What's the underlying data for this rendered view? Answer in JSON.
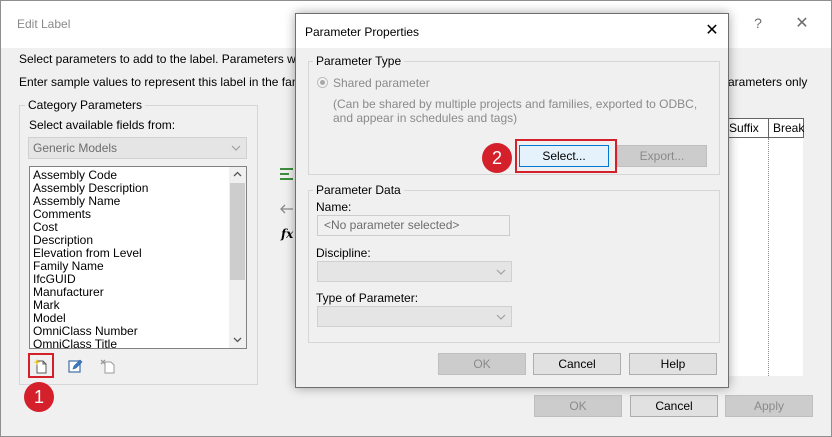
{
  "outer": {
    "title": "Edit Label",
    "help": "?",
    "close": "✕",
    "instruction1": "Select parameters to add to the label.  Parameters will be",
    "instruction2": "Enter sample values to represent this label in the family er",
    "instruction2_right": "arameters only",
    "category_group_label": "Category Parameters",
    "available_label": "Select available fields from:",
    "category_selected": "Generic Models",
    "fields": [
      "Assembly Code",
      "Assembly Description",
      "Assembly Name",
      "Comments",
      "Cost",
      "Description",
      "Elevation from Level",
      "Family Name",
      "IfcGUID",
      "Manufacturer",
      "Mark",
      "Model",
      "OmniClass Number",
      "OmniClass Title"
    ],
    "table_headers": [
      "Suffix",
      "Break"
    ],
    "fx_label": "fx",
    "ok": "OK",
    "cancel": "Cancel",
    "apply": "Apply"
  },
  "markers": {
    "one": "1",
    "two": "2"
  },
  "colors": {
    "highlight": "#d4202a",
    "badge": "#d4202a"
  },
  "pp": {
    "title": "Parameter Properties",
    "close": "✕",
    "type_group_label": "Parameter Type",
    "shared_label": "Shared parameter",
    "shared_desc": "(Can be shared by multiple projects and families, exported to ODBC, and appear in schedules and tags)",
    "select": "Select...",
    "export": "Export...",
    "data_group_label": "Parameter Data",
    "name_label": "Name:",
    "name_value": "<No parameter selected>",
    "discipline_label": "Discipline:",
    "type_label": "Type of Parameter:",
    "ok": "OK",
    "cancel": "Cancel",
    "help": "Help"
  }
}
